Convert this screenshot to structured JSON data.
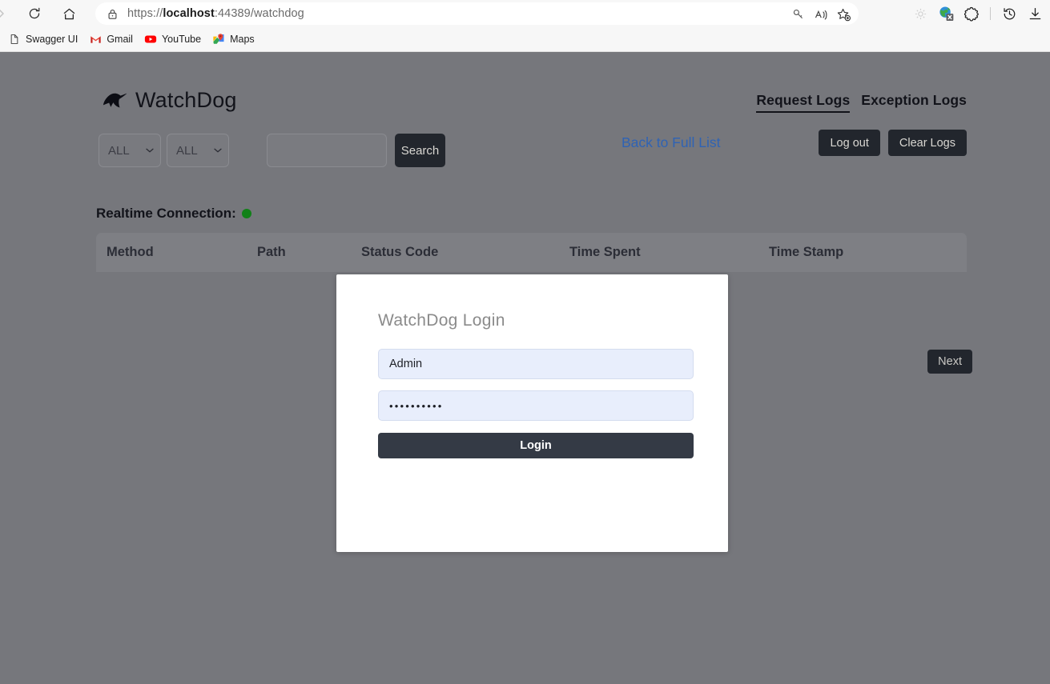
{
  "browser": {
    "url_prefix": "https://",
    "url_host": "localhost",
    "url_suffix": ":44389/watchdog",
    "nav": {
      "forward": "forward-arrow",
      "refresh": "refresh-icon",
      "home": "home-icon"
    },
    "address_icons": {
      "lock": "lock-icon",
      "password_key": "key-icon",
      "read_aloud": "read-aloud-icon",
      "favorite": "add-favorite-icon"
    },
    "toolbar_icons": {
      "collections": "collections-icon",
      "translate": "translate-blocked-icon",
      "extensions": "extensions-puzzle-icon",
      "history": "history-icon",
      "downloads": "downloads-icon"
    },
    "bookmarks": [
      {
        "label": "Swagger UI",
        "icon": "document-icon"
      },
      {
        "label": "Gmail",
        "icon": "gmail-icon"
      },
      {
        "label": "YouTube",
        "icon": "youtube-icon"
      },
      {
        "label": "Maps",
        "icon": "google-maps-icon"
      }
    ]
  },
  "app": {
    "title": "WatchDog",
    "logo_icon": "dog-head-icon",
    "nav_links": [
      {
        "label": "Request Logs",
        "active": true
      },
      {
        "label": "Exception Logs",
        "active": false
      }
    ],
    "filters": {
      "method_select": "ALL",
      "status_select": "ALL",
      "search_value": "",
      "search_placeholder": "",
      "search_button": "Search",
      "caret_icon": "chevron-down-icon"
    },
    "actions": {
      "back_link": "Back to Full List",
      "logout_button": "Log out",
      "clear_logs_button": "Clear Logs"
    },
    "realtime": {
      "label": "Realtime Connection:",
      "status_icon": "green-dot-icon",
      "status_color": "#118118"
    },
    "table": {
      "columns": [
        "Method",
        "Path",
        "Status Code",
        "Time Spent",
        "Time Stamp"
      ],
      "rows": []
    },
    "pagination": {
      "next_button": "Next"
    }
  },
  "login_modal": {
    "title": "WatchDog Login",
    "username_value": "Admin",
    "username_placeholder": "",
    "password_value": "••••••••••",
    "password_placeholder": "",
    "login_button": "Login"
  },
  "colors": {
    "page_overlay": "#76777c",
    "dark_button": "#22262d",
    "link_blue": "#2f63b4",
    "status_green": "#118118",
    "modal_background": "#ffffff",
    "field_background": "#e8eefc"
  }
}
